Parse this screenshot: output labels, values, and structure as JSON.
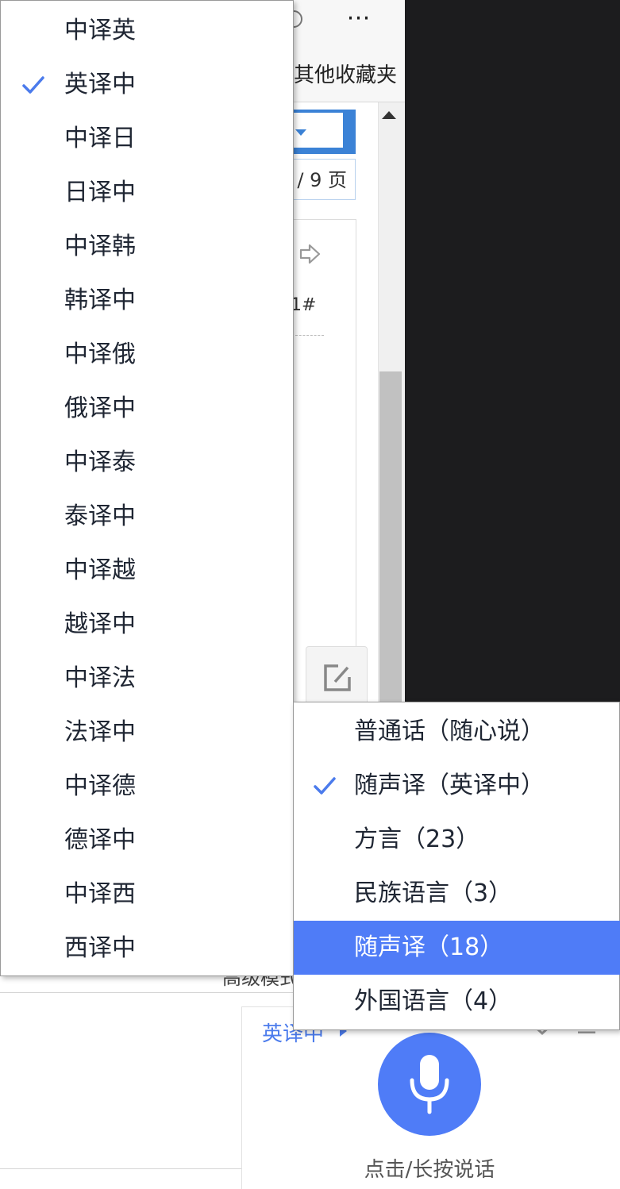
{
  "browser": {
    "more_icon": "⋯",
    "other_favorites": "其他收藏夹",
    "page_indicator": "/ 9 页",
    "doc_mark": "1#",
    "advanced_mode_partial": "高级模式"
  },
  "language_menu": {
    "items": [
      {
        "label": "中译英",
        "checked": false
      },
      {
        "label": "英译中",
        "checked": true
      },
      {
        "label": "中译日",
        "checked": false
      },
      {
        "label": "日译中",
        "checked": false
      },
      {
        "label": "中译韩",
        "checked": false
      },
      {
        "label": "韩译中",
        "checked": false
      },
      {
        "label": "中译俄",
        "checked": false
      },
      {
        "label": "俄译中",
        "checked": false
      },
      {
        "label": "中译泰",
        "checked": false
      },
      {
        "label": "泰译中",
        "checked": false
      },
      {
        "label": "中译越",
        "checked": false
      },
      {
        "label": "越译中",
        "checked": false
      },
      {
        "label": "中译法",
        "checked": false
      },
      {
        "label": "法译中",
        "checked": false
      },
      {
        "label": "中译德",
        "checked": false
      },
      {
        "label": "德译中",
        "checked": false
      },
      {
        "label": "中译西",
        "checked": false
      },
      {
        "label": "西译中",
        "checked": false
      }
    ]
  },
  "mode_menu": {
    "items": [
      {
        "label": "普通话（随心说）",
        "checked": false,
        "highlighted": false
      },
      {
        "label": "随声译（英译中）",
        "checked": true,
        "highlighted": false
      },
      {
        "label": "方言（23）",
        "checked": false,
        "highlighted": false
      },
      {
        "label": "民族语言（3）",
        "checked": false,
        "highlighted": false
      },
      {
        "label": "随声译（18）",
        "checked": false,
        "highlighted": true
      },
      {
        "label": "外国语言（4）",
        "checked": false,
        "highlighted": false
      }
    ]
  },
  "voice_panel": {
    "mode_label": "英译中",
    "mic_hint": "点击/长按说话"
  },
  "colors": {
    "accent": "#4f7cf7",
    "check": "#4b7bec",
    "text": "#1f2633",
    "dark_panel": "#1c1c1e"
  },
  "icons": {
    "check": "check-icon",
    "mic": "microphone-icon",
    "edit": "edit-icon",
    "next": "arrow-right-icon",
    "more": "more-horizontal-icon"
  }
}
